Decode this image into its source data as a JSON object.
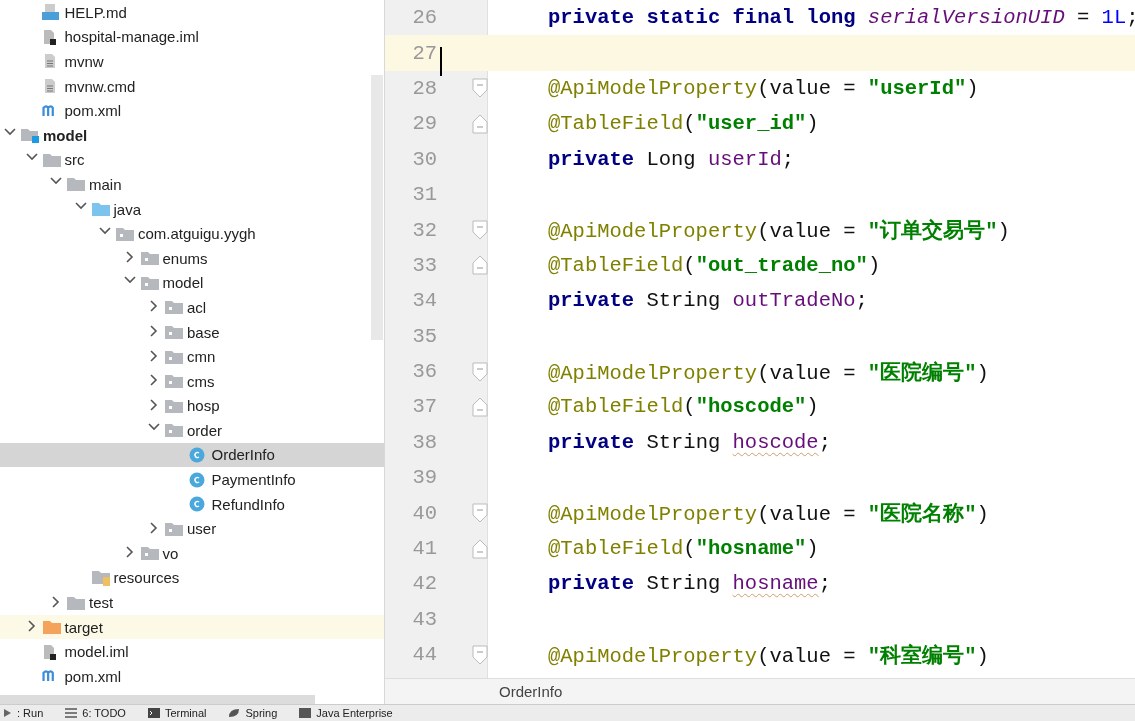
{
  "project_tree": {
    "above": [
      {
        "label": "HELP.md",
        "kind": "markdown"
      },
      {
        "label": "hospital-manage.iml",
        "kind": "iml"
      },
      {
        "label": "mvnw",
        "kind": "text"
      },
      {
        "label": "mvnw.cmd",
        "kind": "text"
      },
      {
        "label": "pom.xml",
        "kind": "maven"
      }
    ],
    "items": [
      {
        "label": "model",
        "kind": "module",
        "expanded": true,
        "selected": false,
        "children": [
          {
            "label": "src",
            "kind": "folder",
            "expanded": true,
            "selected": false,
            "children": [
              {
                "label": "main",
                "kind": "folder",
                "expanded": true,
                "selected": false,
                "children": [
                  {
                    "label": "java",
                    "kind": "source",
                    "expanded": true,
                    "selected": false,
                    "children": [
                      {
                        "label": "com.atguigu.yygh",
                        "kind": "package",
                        "expanded": true,
                        "selected": false,
                        "children": [
                          {
                            "label": "enums",
                            "kind": "package",
                            "expanded": false,
                            "selected": false
                          },
                          {
                            "label": "model",
                            "kind": "package",
                            "expanded": true,
                            "selected": false,
                            "children": [
                              {
                                "label": "acl",
                                "kind": "package",
                                "expanded": false,
                                "selected": false
                              },
                              {
                                "label": "base",
                                "kind": "package",
                                "expanded": false,
                                "selected": false
                              },
                              {
                                "label": "cmn",
                                "kind": "package",
                                "expanded": false,
                                "selected": false
                              },
                              {
                                "label": "cms",
                                "kind": "package",
                                "expanded": false,
                                "selected": false
                              },
                              {
                                "label": "hosp",
                                "kind": "package",
                                "expanded": false,
                                "selected": false
                              },
                              {
                                "label": "order",
                                "kind": "package",
                                "expanded": true,
                                "selected": false,
                                "children": [
                                  {
                                    "label": "OrderInfo",
                                    "kind": "class",
                                    "selected": true
                                  },
                                  {
                                    "label": "PaymentInfo",
                                    "kind": "class",
                                    "selected": false
                                  },
                                  {
                                    "label": "RefundInfo",
                                    "kind": "class",
                                    "selected": false
                                  }
                                ]
                              },
                              {
                                "label": "user",
                                "kind": "package",
                                "expanded": false,
                                "selected": false
                              }
                            ]
                          },
                          {
                            "label": "vo",
                            "kind": "package",
                            "expanded": false,
                            "selected": false
                          }
                        ]
                      }
                    ]
                  },
                  {
                    "label": "resources",
                    "kind": "resources",
                    "selected": false
                  }
                ]
              },
              {
                "label": "test",
                "kind": "folder",
                "expanded": false,
                "selected": false
              }
            ]
          },
          {
            "label": "target",
            "kind": "excluded",
            "expanded": false,
            "selected": false
          },
          {
            "label": "model.iml",
            "kind": "iml",
            "selected": false
          },
          {
            "label": "pom.xml",
            "kind": "maven",
            "selected": false
          }
        ]
      }
    ]
  },
  "editor": {
    "lines": [
      {
        "number": "26",
        "current": false,
        "tokens": [
          {
            "kind": "keyword",
            "text": "private static final long "
          },
          {
            "kind": "static_field",
            "text": "serialVersionUID"
          },
          {
            "kind": "plain",
            "text": " = "
          },
          {
            "kind": "number",
            "text": "1L"
          },
          {
            "kind": "plain",
            "text": ";"
          }
        ]
      },
      {
        "number": "27",
        "current": true
      },
      {
        "number": "28",
        "current": false,
        "kind": "fold_start",
        "tokens": [
          {
            "kind": "annotation",
            "text": "@ApiModelProperty"
          },
          {
            "kind": "plain",
            "text": "(value = "
          },
          {
            "kind": "string",
            "text": "\"userId\""
          },
          {
            "kind": "plain",
            "text": ")"
          }
        ]
      },
      {
        "number": "29",
        "current": false,
        "kind": "fold_end",
        "tokens": [
          {
            "kind": "annotation",
            "text": "@TableField"
          },
          {
            "kind": "plain",
            "text": "("
          },
          {
            "kind": "string",
            "text": "\"user_id\""
          },
          {
            "kind": "plain",
            "text": ")"
          }
        ]
      },
      {
        "number": "30",
        "current": false,
        "tokens": [
          {
            "kind": "keyword",
            "text": "private "
          },
          {
            "kind": "plain",
            "text": "Long "
          },
          {
            "kind": "field",
            "text": "userId"
          },
          {
            "kind": "plain",
            "text": ";"
          }
        ]
      },
      {
        "number": "31",
        "current": false
      },
      {
        "number": "32",
        "current": false,
        "kind": "fold_start",
        "tokens": [
          {
            "kind": "annotation",
            "text": "@ApiModelProperty"
          },
          {
            "kind": "plain",
            "text": "(value = "
          },
          {
            "kind": "string",
            "text": "\"订单交易号\""
          },
          {
            "kind": "plain",
            "text": ")"
          }
        ]
      },
      {
        "number": "33",
        "current": false,
        "kind": "fold_end",
        "tokens": [
          {
            "kind": "annotation",
            "text": "@TableField"
          },
          {
            "kind": "plain",
            "text": "("
          },
          {
            "kind": "string",
            "text": "\"out_trade_no\""
          },
          {
            "kind": "plain",
            "text": ")"
          }
        ]
      },
      {
        "number": "34",
        "current": false,
        "tokens": [
          {
            "kind": "keyword",
            "text": "private "
          },
          {
            "kind": "plain",
            "text": "String "
          },
          {
            "kind": "field",
            "text": "outTradeNo"
          },
          {
            "kind": "plain",
            "text": ";"
          }
        ]
      },
      {
        "number": "35",
        "current": false
      },
      {
        "number": "36",
        "current": false,
        "kind": "fold_start",
        "tokens": [
          {
            "kind": "annotation",
            "text": "@ApiModelProperty"
          },
          {
            "kind": "plain",
            "text": "(value = "
          },
          {
            "kind": "string",
            "text": "\"医院编号\""
          },
          {
            "kind": "plain",
            "text": ")"
          }
        ]
      },
      {
        "number": "37",
        "current": false,
        "kind": "fold_end",
        "tokens": [
          {
            "kind": "annotation",
            "text": "@TableField"
          },
          {
            "kind": "plain",
            "text": "("
          },
          {
            "kind": "string",
            "text": "\"hoscode\""
          },
          {
            "kind": "plain",
            "text": ")"
          }
        ]
      },
      {
        "number": "38",
        "current": false,
        "tokens": [
          {
            "kind": "keyword",
            "text": "private "
          },
          {
            "kind": "plain",
            "text": "String "
          },
          {
            "kind": "typo_field",
            "text": "hoscode"
          },
          {
            "kind": "plain",
            "text": ";"
          }
        ]
      },
      {
        "number": "39",
        "current": false
      },
      {
        "number": "40",
        "current": false,
        "kind": "fold_start",
        "tokens": [
          {
            "kind": "annotation",
            "text": "@ApiModelProperty"
          },
          {
            "kind": "plain",
            "text": "(value = "
          },
          {
            "kind": "string",
            "text": "\"医院名称\""
          },
          {
            "kind": "plain",
            "text": ")"
          }
        ]
      },
      {
        "number": "41",
        "current": false,
        "kind": "fold_end",
        "tokens": [
          {
            "kind": "annotation",
            "text": "@TableField"
          },
          {
            "kind": "plain",
            "text": "("
          },
          {
            "kind": "string",
            "text": "\"hosname\""
          },
          {
            "kind": "plain",
            "text": ")"
          }
        ]
      },
      {
        "number": "42",
        "current": false,
        "tokens": [
          {
            "kind": "keyword",
            "text": "private "
          },
          {
            "kind": "plain",
            "text": "String "
          },
          {
            "kind": "typo_field",
            "text": "hosname"
          },
          {
            "kind": "plain",
            "text": ";"
          }
        ]
      },
      {
        "number": "43",
        "current": false
      },
      {
        "number": "44",
        "current": false,
        "kind": "fold_start",
        "tokens": [
          {
            "kind": "annotation",
            "text": "@ApiModelProperty"
          },
          {
            "kind": "plain",
            "text": "(value = "
          },
          {
            "kind": "string",
            "text": "\"科室编号\""
          },
          {
            "kind": "plain",
            "text": ")"
          }
        ]
      }
    ],
    "breadcrumb": "OrderInfo"
  },
  "tool_window_bar": [
    {
      "label": ": Run",
      "kind": "run"
    },
    {
      "label": "6: TODO",
      "kind": "list"
    },
    {
      "label": "Terminal",
      "kind": "terminal"
    },
    {
      "label": "Spring",
      "kind": "leaf"
    },
    {
      "label": "Java Enterprise",
      "kind": "box"
    }
  ]
}
